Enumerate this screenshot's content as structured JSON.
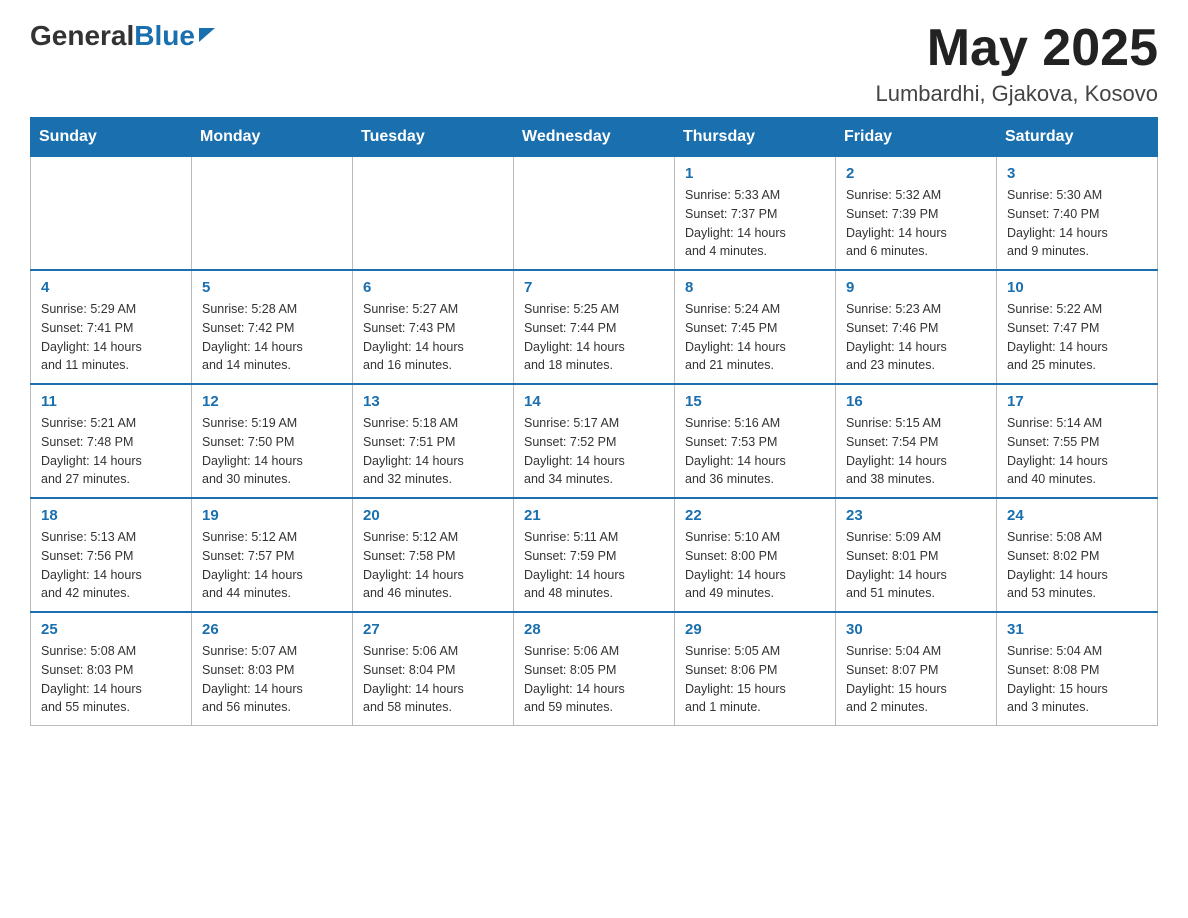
{
  "header": {
    "logo_general": "General",
    "logo_blue": "Blue",
    "month_title": "May 2025",
    "location": "Lumbardhi, Gjakova, Kosovo"
  },
  "weekdays": [
    "Sunday",
    "Monday",
    "Tuesday",
    "Wednesday",
    "Thursday",
    "Friday",
    "Saturday"
  ],
  "weeks": [
    [
      {
        "day": "",
        "info": ""
      },
      {
        "day": "",
        "info": ""
      },
      {
        "day": "",
        "info": ""
      },
      {
        "day": "",
        "info": ""
      },
      {
        "day": "1",
        "info": "Sunrise: 5:33 AM\nSunset: 7:37 PM\nDaylight: 14 hours\nand 4 minutes."
      },
      {
        "day": "2",
        "info": "Sunrise: 5:32 AM\nSunset: 7:39 PM\nDaylight: 14 hours\nand 6 minutes."
      },
      {
        "day": "3",
        "info": "Sunrise: 5:30 AM\nSunset: 7:40 PM\nDaylight: 14 hours\nand 9 minutes."
      }
    ],
    [
      {
        "day": "4",
        "info": "Sunrise: 5:29 AM\nSunset: 7:41 PM\nDaylight: 14 hours\nand 11 minutes."
      },
      {
        "day": "5",
        "info": "Sunrise: 5:28 AM\nSunset: 7:42 PM\nDaylight: 14 hours\nand 14 minutes."
      },
      {
        "day": "6",
        "info": "Sunrise: 5:27 AM\nSunset: 7:43 PM\nDaylight: 14 hours\nand 16 minutes."
      },
      {
        "day": "7",
        "info": "Sunrise: 5:25 AM\nSunset: 7:44 PM\nDaylight: 14 hours\nand 18 minutes."
      },
      {
        "day": "8",
        "info": "Sunrise: 5:24 AM\nSunset: 7:45 PM\nDaylight: 14 hours\nand 21 minutes."
      },
      {
        "day": "9",
        "info": "Sunrise: 5:23 AM\nSunset: 7:46 PM\nDaylight: 14 hours\nand 23 minutes."
      },
      {
        "day": "10",
        "info": "Sunrise: 5:22 AM\nSunset: 7:47 PM\nDaylight: 14 hours\nand 25 minutes."
      }
    ],
    [
      {
        "day": "11",
        "info": "Sunrise: 5:21 AM\nSunset: 7:48 PM\nDaylight: 14 hours\nand 27 minutes."
      },
      {
        "day": "12",
        "info": "Sunrise: 5:19 AM\nSunset: 7:50 PM\nDaylight: 14 hours\nand 30 minutes."
      },
      {
        "day": "13",
        "info": "Sunrise: 5:18 AM\nSunset: 7:51 PM\nDaylight: 14 hours\nand 32 minutes."
      },
      {
        "day": "14",
        "info": "Sunrise: 5:17 AM\nSunset: 7:52 PM\nDaylight: 14 hours\nand 34 minutes."
      },
      {
        "day": "15",
        "info": "Sunrise: 5:16 AM\nSunset: 7:53 PM\nDaylight: 14 hours\nand 36 minutes."
      },
      {
        "day": "16",
        "info": "Sunrise: 5:15 AM\nSunset: 7:54 PM\nDaylight: 14 hours\nand 38 minutes."
      },
      {
        "day": "17",
        "info": "Sunrise: 5:14 AM\nSunset: 7:55 PM\nDaylight: 14 hours\nand 40 minutes."
      }
    ],
    [
      {
        "day": "18",
        "info": "Sunrise: 5:13 AM\nSunset: 7:56 PM\nDaylight: 14 hours\nand 42 minutes."
      },
      {
        "day": "19",
        "info": "Sunrise: 5:12 AM\nSunset: 7:57 PM\nDaylight: 14 hours\nand 44 minutes."
      },
      {
        "day": "20",
        "info": "Sunrise: 5:12 AM\nSunset: 7:58 PM\nDaylight: 14 hours\nand 46 minutes."
      },
      {
        "day": "21",
        "info": "Sunrise: 5:11 AM\nSunset: 7:59 PM\nDaylight: 14 hours\nand 48 minutes."
      },
      {
        "day": "22",
        "info": "Sunrise: 5:10 AM\nSunset: 8:00 PM\nDaylight: 14 hours\nand 49 minutes."
      },
      {
        "day": "23",
        "info": "Sunrise: 5:09 AM\nSunset: 8:01 PM\nDaylight: 14 hours\nand 51 minutes."
      },
      {
        "day": "24",
        "info": "Sunrise: 5:08 AM\nSunset: 8:02 PM\nDaylight: 14 hours\nand 53 minutes."
      }
    ],
    [
      {
        "day": "25",
        "info": "Sunrise: 5:08 AM\nSunset: 8:03 PM\nDaylight: 14 hours\nand 55 minutes."
      },
      {
        "day": "26",
        "info": "Sunrise: 5:07 AM\nSunset: 8:03 PM\nDaylight: 14 hours\nand 56 minutes."
      },
      {
        "day": "27",
        "info": "Sunrise: 5:06 AM\nSunset: 8:04 PM\nDaylight: 14 hours\nand 58 minutes."
      },
      {
        "day": "28",
        "info": "Sunrise: 5:06 AM\nSunset: 8:05 PM\nDaylight: 14 hours\nand 59 minutes."
      },
      {
        "day": "29",
        "info": "Sunrise: 5:05 AM\nSunset: 8:06 PM\nDaylight: 15 hours\nand 1 minute."
      },
      {
        "day": "30",
        "info": "Sunrise: 5:04 AM\nSunset: 8:07 PM\nDaylight: 15 hours\nand 2 minutes."
      },
      {
        "day": "31",
        "info": "Sunrise: 5:04 AM\nSunset: 8:08 PM\nDaylight: 15 hours\nand 3 minutes."
      }
    ]
  ]
}
